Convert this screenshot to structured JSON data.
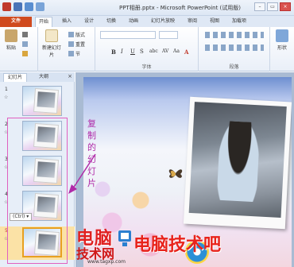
{
  "window": {
    "title": "PPT相册.pptx - Microsoft PowerPoint (试用版)",
    "controls": [
      "–",
      "▭",
      "×"
    ]
  },
  "tabs": {
    "file": "文件",
    "items": [
      "开始",
      "插入",
      "设计",
      "切换",
      "动画",
      "幻灯片放映",
      "审阅",
      "视图",
      "加载项"
    ]
  },
  "ribbon": {
    "paste": "粘贴",
    "new_slide": "新建幻灯片",
    "layout": "版式",
    "reset": "重置",
    "section": "节",
    "font_label": "字体",
    "paragraph_label": "段落",
    "format_buttons": [
      "B",
      "I",
      "U",
      "S",
      "abc",
      "AV",
      "Aa",
      "A"
    ],
    "shape_label": "形状"
  },
  "pane": {
    "tabs": [
      "幻灯片",
      "大纲"
    ],
    "close": "×",
    "slides": [
      {
        "num": "1",
        "star": "☆"
      },
      {
        "num": "2",
        "star": "☆"
      },
      {
        "num": "3",
        "star": "☆"
      },
      {
        "num": "4",
        "star": "☆"
      },
      {
        "num": "5",
        "star": "☆"
      }
    ],
    "ctrl_tag": "(Ctrl) ▾"
  },
  "annotation": "复制的幻灯片",
  "watermark": {
    "left_top": "电脑",
    "left_bottom": "技术网",
    "right": "电脑技术吧",
    "footer": "www.tagxp.com"
  }
}
